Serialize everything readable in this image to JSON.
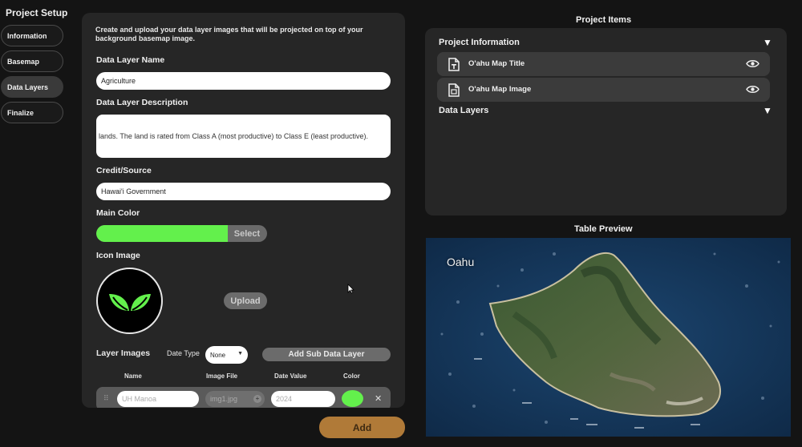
{
  "sidebar": {
    "title": "Project Setup",
    "items": [
      {
        "label": "Information"
      },
      {
        "label": "Basemap"
      },
      {
        "label": "Data Layers",
        "active": true
      },
      {
        "label": "Finalize"
      }
    ]
  },
  "form": {
    "intro": "Create and upload your data layer images that will be projected on top of your background basemap image.",
    "name_label": "Data Layer Name",
    "name_value": "Agriculture",
    "description_label": "Data Layer Description",
    "description_value": "lands. The land is rated from Class A (most productive) to Class E (least productive).",
    "credit_label": "Credit/Source",
    "credit_value": "Hawai'i Government",
    "main_color_label": "Main Color",
    "main_color_value": "#63f04c",
    "main_color_select": "Select",
    "icon_image_label": "Icon Image",
    "icon_name": "leaves-icon",
    "upload_label": "Upload",
    "layer_images_label": "Layer Images",
    "date_type_label": "Date Type",
    "date_type_value": "None",
    "add_sub_label": "Add Sub Data Layer",
    "columns": [
      "Name",
      "Image File",
      "Date Value",
      "Color"
    ],
    "sub_layer": {
      "name_placeholder": "UH Manoa",
      "file_placeholder": "img1.jpg",
      "file_add": "+",
      "date_placeholder": "2024",
      "color": "#63f04c",
      "delete": "✕",
      "handle": "⠿"
    },
    "add_label": "Add"
  },
  "project_items": {
    "title": "Project Items",
    "groups": [
      {
        "label": "Project Information",
        "toggle": "▼",
        "items": [
          {
            "label": "O'ahu Map Title"
          },
          {
            "label": "O'ahu Map Image"
          }
        ]
      },
      {
        "label": "Data Layers",
        "toggle": "▼",
        "items": []
      }
    ]
  },
  "table_preview": {
    "title": "Table Preview",
    "map_label": "Oahu"
  },
  "colors": {
    "accent_green": "#63f04c",
    "add_button": "#b07a38",
    "panel": "#262626",
    "background": "#141414"
  }
}
